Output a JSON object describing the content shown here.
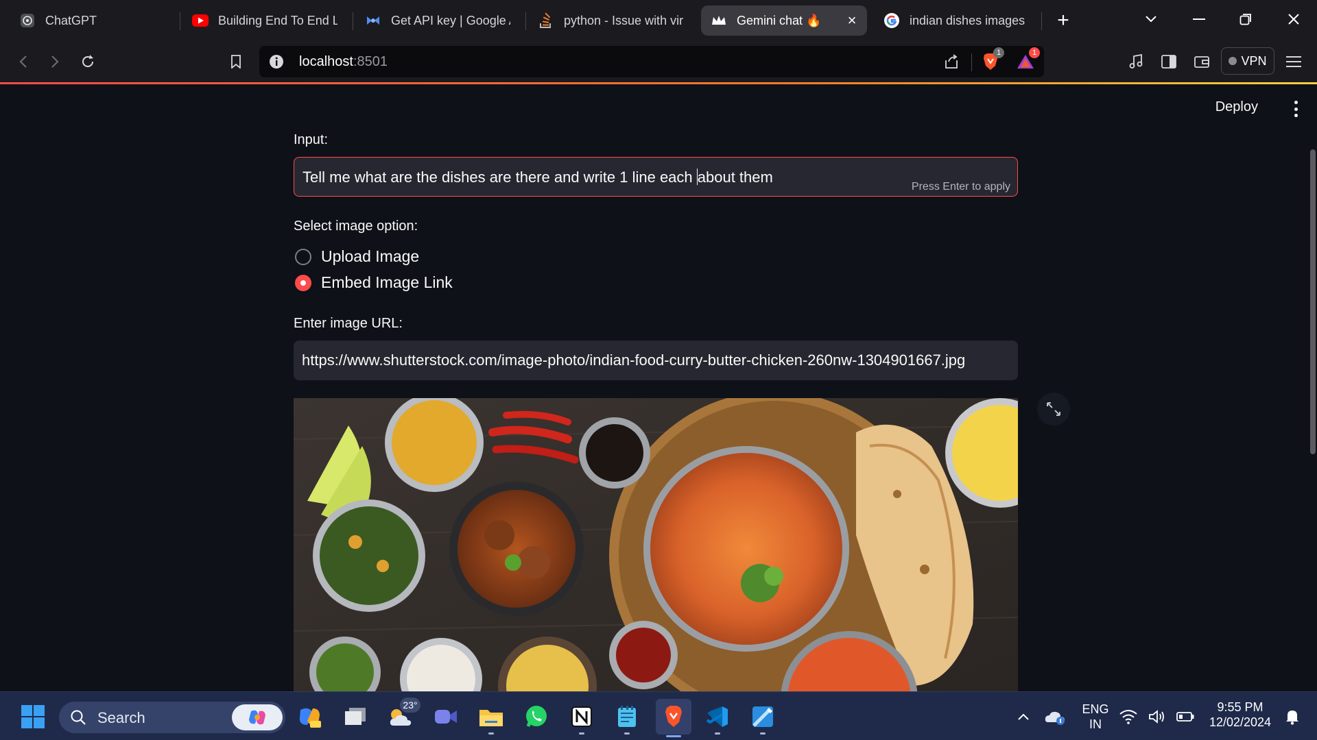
{
  "browser": {
    "tabs": [
      {
        "label": "ChatGPT",
        "icon": "chatgpt-icon"
      },
      {
        "label": "Building End To End LLM",
        "icon": "youtube-icon"
      },
      {
        "label": "Get API key | Google AI",
        "icon": "google-ai-studio-icon"
      },
      {
        "label": "python - Issue with virt",
        "icon": "stackoverflow-icon"
      },
      {
        "label": "Gemini chat 🔥",
        "icon": "streamlit-crown-icon",
        "active": true
      },
      {
        "label": "indian dishes images -",
        "icon": "google-icon"
      }
    ],
    "url_host": "localhost",
    "url_port": ":8501",
    "brave_badge": "1",
    "rewards_badge": "1",
    "vpn_label": "VPN"
  },
  "app": {
    "deploy_label": "Deploy",
    "input_label": "Input:",
    "input_value_before_caret": "Tell me what are the dishes are there and write 1 line each ",
    "input_value_after_caret": "about them",
    "input_hint": "Press Enter to apply",
    "radio_label": "Select image option:",
    "radio_options": [
      {
        "label": "Upload Image",
        "selected": false
      },
      {
        "label": "Embed Image Link",
        "selected": true
      }
    ],
    "url_label": "Enter image URL:",
    "url_value": "https://www.shutterstock.com/image-photo/indian-food-curry-butter-chicken-260nw-1304901667.jpg",
    "accent_color": "#ff4b4b"
  },
  "taskbar": {
    "search_label": "Search",
    "weather_temp": "23°",
    "lang_top": "ENG",
    "lang_bottom": "IN",
    "time": "9:55 PM",
    "date": "12/02/2024"
  }
}
